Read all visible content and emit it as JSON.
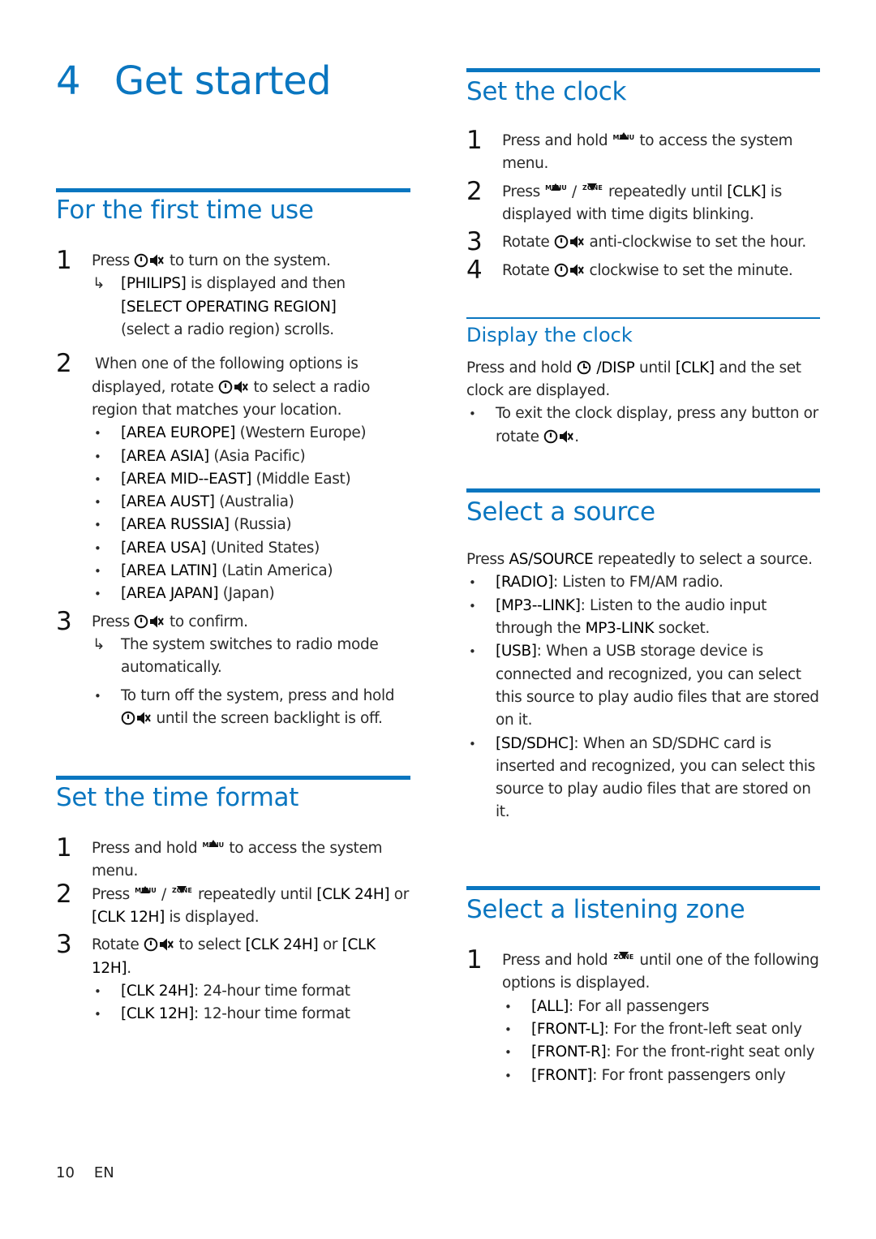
{
  "chapter": {
    "number": "4",
    "title": "Get started"
  },
  "first_time_use": {
    "title": "For the first time use",
    "step1": {
      "num": "1",
      "pre": "Press",
      "post": "to turn on the system.",
      "result_marker": "↳",
      "result_b1": "[PHILIPS]",
      "result_t1": "is displayed and then",
      "result_b2": "[SELECT OPERATING REGION]",
      "result_t2": "(select a radio region) scrolls."
    },
    "step2": {
      "num": "2",
      "line1": "When one of the following options is",
      "pre": "displayed, rotate",
      "post": "to select a radio",
      "line3": "region that matches your location."
    },
    "regions": [
      {
        "code": "[AREA EUROPE]",
        "name": "(Western Europe)"
      },
      {
        "code": "[AREA ASIA]",
        "name": "(Asia Pacific)"
      },
      {
        "code": "[AREA MID--EAST]",
        "name": "(Middle East)"
      },
      {
        "code": "[AREA AUST]",
        "name": "(Australia)"
      },
      {
        "code": "[AREA RUSSIA]",
        "name": "(Russia)"
      },
      {
        "code": "[AREA USA]",
        "name": "(United States)"
      },
      {
        "code": "[AREA LATIN]",
        "name": "(Latin America)"
      },
      {
        "code": "[AREA JAPAN]",
        "name": "(Japan)"
      }
    ],
    "step3": {
      "num": "3",
      "pre": "Press",
      "post": "to confirm.",
      "result": "The system switches to radio mode automatically.",
      "note_pre": "To turn off the system, press and hold",
      "note_post": "until the screen backlight is off."
    }
  },
  "time_format": {
    "title": "Set the time format",
    "step1": {
      "num": "1",
      "pre": "Press and hold",
      "post": "to access the system menu."
    },
    "step2": {
      "num": "2",
      "pre": "Press",
      "sep": "/",
      "mid": "repeatedly until",
      "b1": "[CLK 24H]",
      "or": "or",
      "b2": "[CLK 12H]",
      "post": "is displayed."
    },
    "step3": {
      "num": "3",
      "pre": "Rotate",
      "mid": "to select",
      "b1": "[CLK 24H]",
      "or": "or",
      "b2": "[CLK 12H]",
      "end": "."
    },
    "options": [
      {
        "code": "[CLK 24H]",
        "desc": ": 24-hour time format"
      },
      {
        "code": "[CLK 12H]",
        "desc": ": 12-hour time format"
      }
    ]
  },
  "set_clock": {
    "title": "Set the clock",
    "step1": {
      "num": "1",
      "pre": "Press and hold",
      "post": "to access the system menu."
    },
    "step2": {
      "num": "2",
      "pre": "Press",
      "sep": "/",
      "mid": "repeatedly until",
      "b1": "[CLK]",
      "post": "is displayed with time digits blinking."
    },
    "step3": {
      "num": "3",
      "pre": "Rotate",
      "post": "anti-clockwise to set the hour."
    },
    "step4": {
      "num": "4",
      "pre": "Rotate",
      "post": "clockwise to set the minute."
    }
  },
  "display_clock": {
    "title": "Display the clock",
    "pre": "Press and hold",
    "key": "/DISP",
    "mid": "until",
    "b1": "[CLK]",
    "post": "and the set clock are displayed.",
    "note_pre": "To exit the clock display, press any button or rotate",
    "note_post": "."
  },
  "select_source": {
    "title": "Select a source",
    "pre": "Press",
    "key": "AS/SOURCE",
    "post": "repeatedly to select a source.",
    "items": [
      {
        "code": "[RADIO]",
        "desc": ": Listen to FM/AM radio."
      },
      {
        "code": "[MP3--LINK]",
        "desc": ": Listen to the audio input through the",
        "key": "MP3-LINK",
        "desc2": "socket."
      },
      {
        "code": "[USB]",
        "desc": ": When a USB storage device is connected and recognized, you can select this source to play audio files that are stored on it."
      },
      {
        "code": "[SD/SDHC]",
        "desc": ": When an SD/SDHC card is inserted and recognized, you can select this source to play audio files that are stored on it."
      }
    ]
  },
  "listening_zone": {
    "title": "Select a listening zone",
    "step1": {
      "num": "1",
      "pre": "Press and hold",
      "post": "until one of the following options is displayed."
    },
    "options": [
      {
        "code": "[ALL]",
        "desc": ": For all passengers"
      },
      {
        "code": "[FRONT-L]",
        "desc": ": For the front-left seat only"
      },
      {
        "code": "[FRONT-R]",
        "desc": ": For the front-right seat only"
      },
      {
        "code": "[FRONT]",
        "desc": ": For front passengers only"
      }
    ]
  },
  "keys": {
    "menu": "MENU",
    "zone": "ZONE"
  },
  "icons": {
    "bullet": "•",
    "arrow": "↳"
  },
  "footer": {
    "page": "10",
    "lang": "EN"
  }
}
